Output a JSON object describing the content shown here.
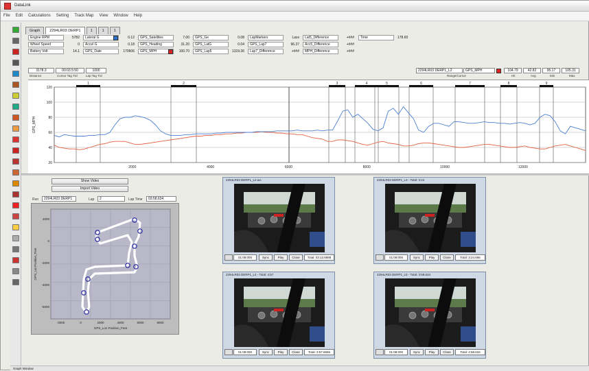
{
  "window": {
    "title": "DataLink",
    "menu": [
      "File",
      "Edit",
      "Calculations",
      "Setting",
      "Track Map",
      "View",
      "Window",
      "Help"
    ]
  },
  "tabs": [
    {
      "label": "Graph"
    },
    {
      "label": "2294LR03 DERP1"
    },
    {
      "label": "1"
    },
    {
      "label": "1"
    },
    {
      "label": "1"
    }
  ],
  "params": [
    {
      "label": "Engine RPM",
      "value": "5782"
    },
    {
      "label": "Wheel Speed",
      "value": "0"
    },
    {
      "label": "Battery Volt",
      "value": "14.1"
    },
    {
      "label": "Lateral G",
      "value": "0.12"
    },
    {
      "label": "Accel G",
      "value": "0.18"
    },
    {
      "label": "GPS_Date",
      "value": "170606"
    },
    {
      "label": "GPS_Satellites",
      "value": "7.00"
    },
    {
      "label": "GPS_Heading",
      "value": "31.20"
    },
    {
      "label": "GPS_MPH",
      "value": "100.70"
    },
    {
      "label": "GPS_Ge",
      "value": "0.08"
    },
    {
      "label": "GPS_LatG",
      "value": "0.04"
    },
    {
      "label": "GPS_Lap5",
      "value": "1319.36"
    },
    {
      "label": "LapMarkers",
      "value": "Laxx"
    },
    {
      "label": "GPS_Lap7",
      "value": "96.37"
    },
    {
      "label": "Lap7_Difference",
      "value": "+###"
    },
    {
      "label": "Lat5_Difference",
      "value": "+###"
    },
    {
      "label": "Acc5_Difference",
      "value": "+###"
    },
    {
      "label": "MPH_Difference",
      "value": "+###"
    }
  ],
  "time": {
    "label": "Time",
    "value": "178.60"
  },
  "readouts_left": {
    "distance": "3178.3",
    "time": "00:03.5:50",
    "lap_time": "1000",
    "labels": [
      "Distance",
      "Cursor Tag Trd",
      "Lap Tag Trd"
    ]
  },
  "readouts_right": {
    "channel": "2294LR03 DERP1_L2",
    "channel_name": "GPS_MPH",
    "values": [
      "104.79",
      "42.82",
      "95.17",
      "105.31"
    ],
    "labels": [
      "Range/Cursor",
      "Hit",
      "Avg",
      "Min",
      "Max"
    ]
  },
  "plot": {
    "y_axis_label": "GPS_MPH",
    "y_ticks": [
      "120",
      "100",
      "80",
      "60",
      "40",
      "20"
    ],
    "x_ticks": [
      "2000",
      "4000",
      "6000",
      "8000",
      "10000",
      "12000"
    ],
    "segment_labels": [
      "1",
      "2",
      "3",
      "4",
      "5",
      "6",
      "7",
      "8",
      "9",
      "10"
    ],
    "series_colors": {
      "speed": "#4a7fcf",
      "reference": "#e06040"
    },
    "speed_series": [
      56,
      54,
      57,
      56,
      55,
      55,
      55,
      56,
      56,
      57,
      57,
      60,
      70,
      78,
      80,
      80,
      82,
      81,
      79,
      76,
      70,
      62,
      58,
      56,
      56,
      56,
      57,
      57,
      58,
      58,
      58,
      58,
      59,
      59,
      60,
      60,
      60,
      60,
      60,
      60,
      61,
      61,
      61,
      61,
      62,
      62,
      62,
      62,
      63,
      62,
      62,
      62,
      63,
      62,
      63,
      63,
      75,
      88,
      90,
      80,
      84,
      78,
      72,
      64,
      62,
      66,
      88,
      92,
      84,
      94,
      86,
      78,
      63,
      60,
      68,
      72,
      72,
      70,
      68,
      74,
      74,
      73,
      72,
      72,
      73,
      74,
      73,
      73,
      72,
      72,
      71,
      72,
      73,
      72,
      70,
      72,
      80,
      84,
      82,
      74,
      62,
      58,
      68,
      66,
      64,
      62
    ],
    "reference_series": [
      43,
      40,
      39,
      38,
      38,
      37,
      38,
      40,
      42,
      44,
      45,
      47,
      48,
      48,
      48,
      46,
      44,
      44,
      45,
      46,
      47,
      48,
      49,
      50,
      51,
      52,
      53,
      54,
      55,
      55,
      56,
      56,
      57,
      57,
      58,
      58,
      59,
      59,
      60,
      60,
      60,
      61,
      60,
      60,
      59,
      59,
      58,
      58,
      57,
      57,
      55,
      53,
      52,
      51,
      48,
      48,
      50,
      50,
      49,
      48,
      46,
      44,
      43,
      45,
      47,
      48,
      46,
      45,
      44,
      42,
      42,
      43,
      45,
      46,
      46,
      45,
      44,
      43,
      42,
      41,
      40,
      40,
      41,
      42,
      43,
      44,
      44,
      43,
      42,
      41,
      40,
      40,
      41,
      42,
      40,
      39,
      38,
      38,
      40,
      42,
      43,
      44,
      42,
      40,
      38,
      36
    ]
  },
  "video_controls": {
    "show_video": "Show Video",
    "import_video": "Import Video"
  },
  "track": {
    "run_label": "Run",
    "run_value": "2294LR03 DERP1",
    "lap_label": "Lap",
    "lap_value": "2",
    "laptime_label": "Lap Time",
    "laptime_value": "03:58.634",
    "y_label": "GPS_Lat Position_Feet",
    "x_label": "GPS_Lon Position_Feet",
    "x_ticks": [
      "-2000",
      "0",
      "2000",
      "4000",
      "6000",
      "8000"
    ],
    "y_ticks": [
      "2000",
      "0",
      "-2000",
      "-4000",
      "-6000"
    ]
  },
  "videos": [
    {
      "title": "2294LR03 DERP1_L2.avi",
      "time": "01:08:000",
      "sync": "Sync",
      "play": "Play",
      "close": "Close",
      "total": "Total: 03:13.6888"
    },
    {
      "title": "2294LR03 DERP1_L3 - Total: 3:24",
      "time": "01:08:000",
      "sync": "Sync",
      "play": "Play",
      "close": "Close",
      "total": "Total: 3:24.666"
    },
    {
      "title": "2294LR03 DERP1_L4 - Total: 4:57",
      "time": "01:08:000",
      "sync": "Sync",
      "play": "Play",
      "close": "Close",
      "total": "Total: 3:57.6666"
    },
    {
      "title": "2294LR03 DERP1_L5 - Total: 3:58.634",
      "time": "01:08:000",
      "sync": "Sync",
      "play": "Play",
      "close": "Close",
      "total": "Total: 4:58.634"
    }
  ],
  "status": {
    "tab": "Graph Window"
  }
}
